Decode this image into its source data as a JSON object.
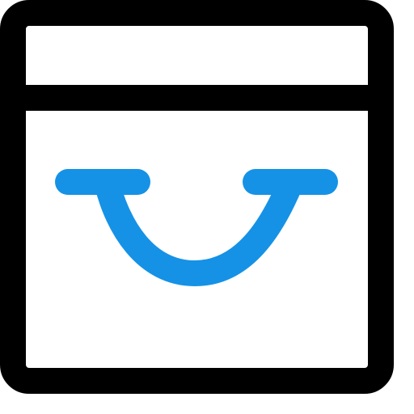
{
  "icon": {
    "name": "browser-window-smile-icon",
    "colors": {
      "frame": "#000000",
      "smile": "#1592E6",
      "background": "#FFFFFF"
    }
  }
}
